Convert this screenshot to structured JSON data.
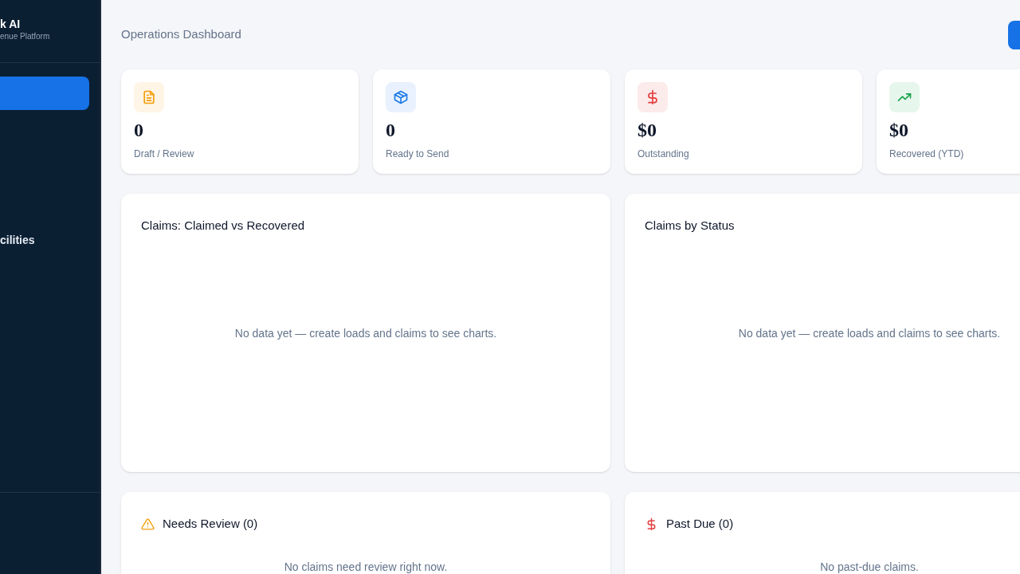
{
  "sidebar": {
    "brand": "k AI",
    "tagline": "enue Platform",
    "items": [
      {
        "selected": true
      },
      {
        "label": "cilities",
        "selected": false
      }
    ]
  },
  "header": {
    "title": "Operations Dashboard"
  },
  "stats": [
    {
      "kind": "document",
      "value": "0",
      "label": "Draft / Review",
      "color": "#f59e0b"
    },
    {
      "kind": "box",
      "value": "0",
      "label": "Ready to Send",
      "color": "#1d7ae8"
    },
    {
      "kind": "dollar",
      "value": "$0",
      "label": "Outstanding",
      "color": "#e53e3e"
    },
    {
      "kind": "trend",
      "value": "$0",
      "label": "Recovered (YTD)",
      "color": "#16a34a"
    }
  ],
  "charts": [
    {
      "title": "Claims: Claimed vs Recovered",
      "empty": "No data yet — create loads and claims to see charts."
    },
    {
      "title": "Claims by Status",
      "empty": "No data yet — create loads and claims to see charts."
    }
  ],
  "lists": [
    {
      "kind": "warning",
      "title": "Needs Review (0)",
      "empty": "No claims need review right now."
    },
    {
      "kind": "dollar",
      "title": "Past Due (0)",
      "empty": "No past-due claims."
    }
  ]
}
